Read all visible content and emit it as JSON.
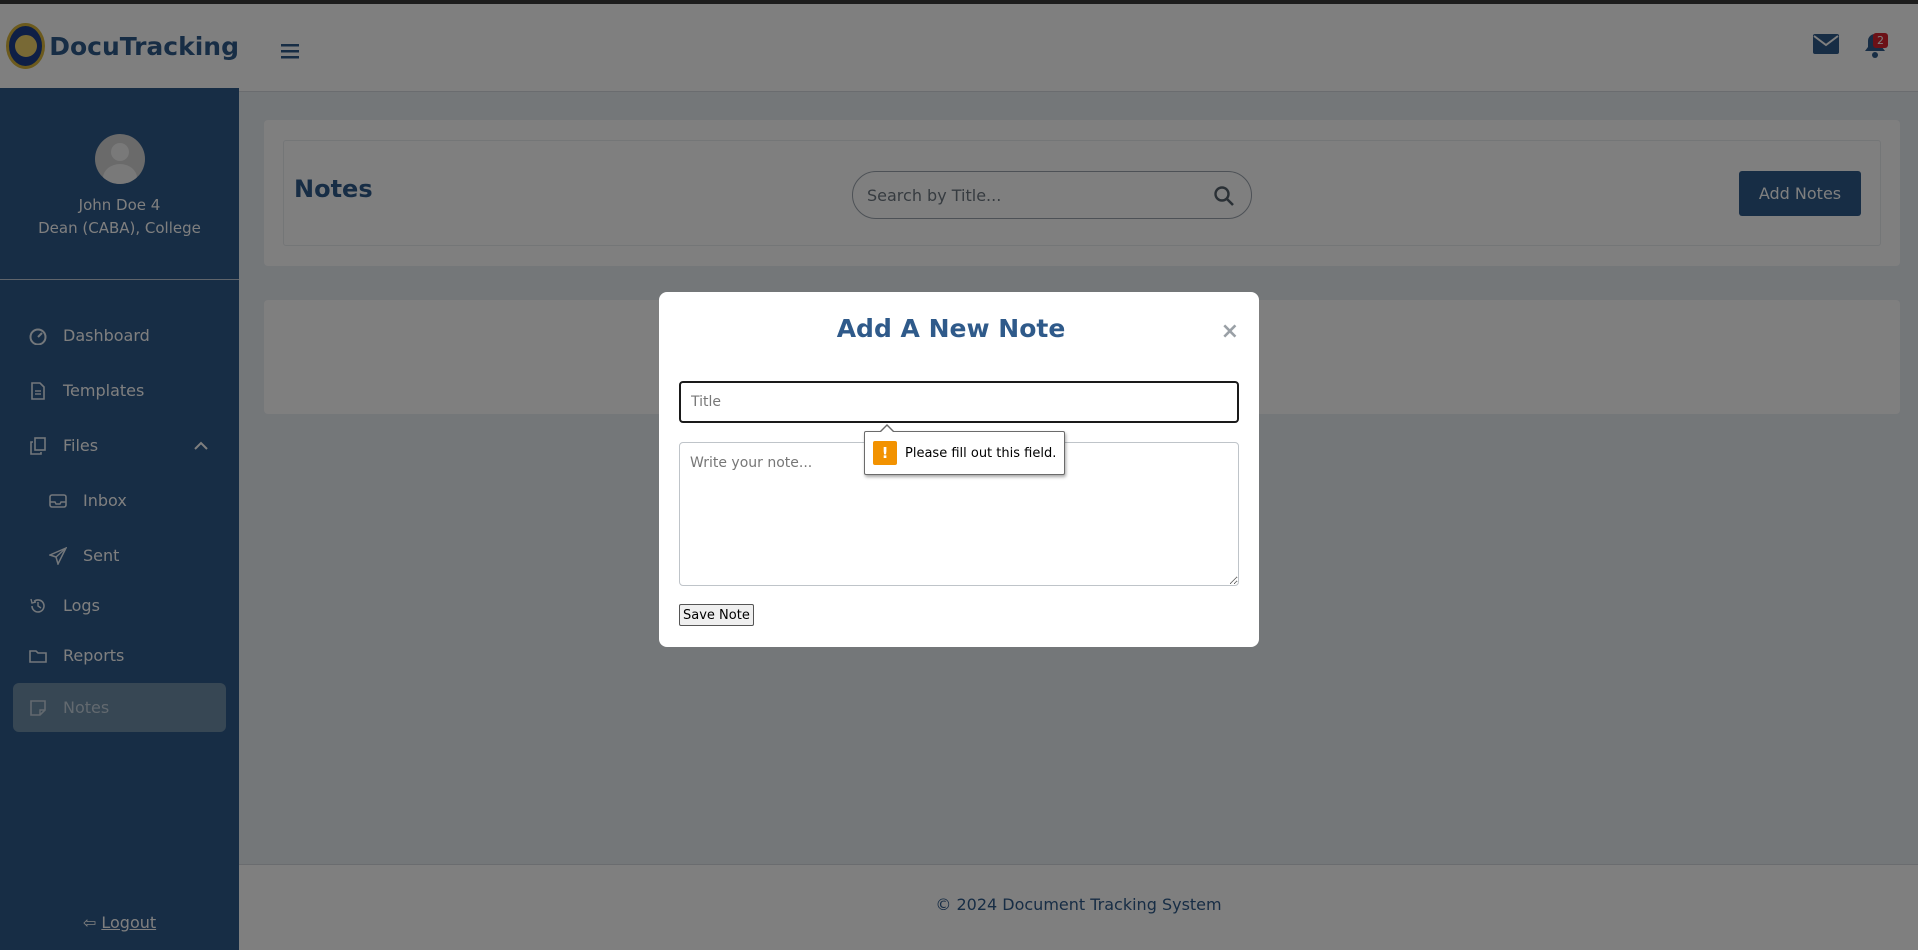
{
  "brand": {
    "name": "DocuTracking",
    "logo": "university-seal-logo"
  },
  "profile": {
    "name": "John Doe 4",
    "role": "Dean (CABA), College"
  },
  "sidebar": {
    "items": [
      {
        "label": "Dashboard",
        "icon": "dashboard-gauge-icon"
      },
      {
        "label": "Templates",
        "icon": "document-icon"
      },
      {
        "label": "Files",
        "icon": "copy-files-icon",
        "expanded": true
      },
      {
        "label": "Inbox",
        "icon": "inbox-tray-icon",
        "sub": true
      },
      {
        "label": "Sent",
        "icon": "paper-plane-icon",
        "sub": true
      },
      {
        "label": "Logs",
        "icon": "history-icon"
      },
      {
        "label": "Reports",
        "icon": "folder-icon"
      },
      {
        "label": "Notes",
        "icon": "sticky-note-icon",
        "active": true
      }
    ],
    "logout_label": "Logout"
  },
  "header": {
    "notification_count": "2"
  },
  "main": {
    "title": "Notes",
    "search_placeholder": "Search by Title...",
    "add_button": "Add Notes"
  },
  "modal": {
    "title": "Add A New Note",
    "close_symbol": "×",
    "title_placeholder": "Title",
    "note_placeholder": "Write your note...",
    "save_button": "Save Note"
  },
  "validation": {
    "message": "Please fill out this field.",
    "icon_symbol": "!"
  },
  "footer": {
    "text": "© 2024 Document Tracking System"
  },
  "colors": {
    "primary": "#2f5a8a",
    "overlay": "rgba(0,0,0,0.5)",
    "badge": "#d9232e",
    "warning": "#f29200"
  }
}
